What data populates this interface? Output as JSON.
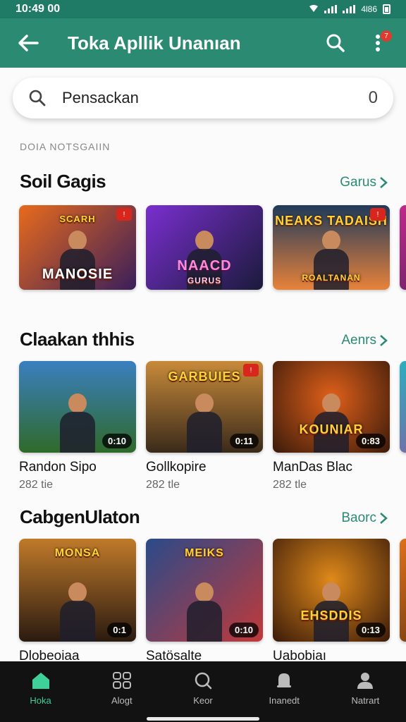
{
  "status_bar": {
    "time": "10:49 00",
    "signal_text": "4l86"
  },
  "app_bar": {
    "title": "Toka Apllik Unanıan",
    "notification_count": "7"
  },
  "search": {
    "placeholder": "Pensackan",
    "count": "0"
  },
  "overline": "DOIA NOTSGAIIN",
  "sections": [
    {
      "title": "Soil Gagis",
      "more": "Garus",
      "cards": [
        {
          "label": "MANOSIE",
          "subtitle": "SCARH",
          "badge": "!",
          "colors": [
            "#e86a1c",
            "#3a1e5a"
          ]
        },
        {
          "label": "NAACD",
          "subtitle": "GURUS",
          "colors": [
            "#7a2fd0",
            "#1a1a3a"
          ]
        },
        {
          "label": "NEAKS TADAISH",
          "subtitle": "ROALTANAN",
          "badge": "!",
          "colors": [
            "#1f3a5a",
            "#e8823a"
          ]
        }
      ]
    },
    {
      "title": "Claakan thhis",
      "more": "Aenrs",
      "cards": [
        {
          "name": "Randon Sipo",
          "meta": "282 tie",
          "duration": "0:10",
          "colors": [
            "#3a7fc0",
            "#2f6a2a"
          ]
        },
        {
          "name": "Gollkopire",
          "meta": "282 tle",
          "duration": "0:11",
          "label": "GARBUIES",
          "badge": "!",
          "colors": [
            "#c88a3a",
            "#3a2a1a"
          ]
        },
        {
          "name": "ManDas Blac",
          "meta": "282 tle",
          "duration": "0:83",
          "label": "KOUNIAR",
          "colors": [
            "#e0601a",
            "#3a1a0a"
          ]
        }
      ]
    },
    {
      "title": "CabgenUlaton",
      "more": "Baorc",
      "cards": [
        {
          "name": "Dlobeoiaa",
          "duration": "0:1",
          "label": "MONSA",
          "colors": [
            "#c07a2a",
            "#2a1a10"
          ]
        },
        {
          "name": "Satösalte",
          "duration": "0:10",
          "label": "MEIKS",
          "colors": [
            "#2a4a8a",
            "#c03a3a"
          ]
        },
        {
          "name": "Uabobiaı",
          "duration": "0:13",
          "label": "EHSDDIS",
          "colors": [
            "#e08a1a",
            "#3a1a0a"
          ]
        }
      ]
    }
  ],
  "bottom_nav": [
    {
      "label": "Hoka",
      "icon": "home-icon",
      "active": true
    },
    {
      "label": "Alogt",
      "icon": "grid-icon"
    },
    {
      "label": "Keor",
      "icon": "search-icon"
    },
    {
      "label": "Inanedt",
      "icon": "bell-icon"
    },
    {
      "label": "Natrart",
      "icon": "profile-icon"
    }
  ],
  "colors": {
    "primary": "#2a8a72",
    "status_bar": "#1f7a66",
    "accent_active": "#3fcf99",
    "nav_bg": "#121212"
  }
}
